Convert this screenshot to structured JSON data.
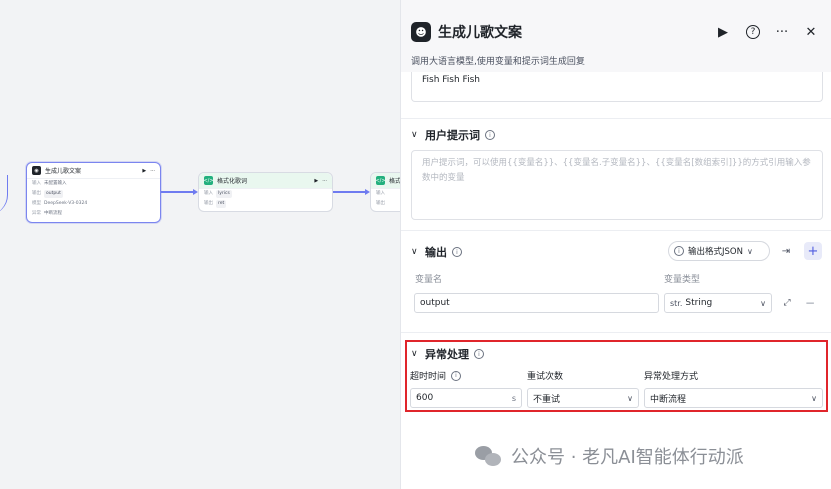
{
  "canvas": {
    "node1": {
      "title": "生成儿歌文案",
      "rows": [
        {
          "k": "输入",
          "v": "未配置输入"
        },
        {
          "k": "输出",
          "v": "output"
        },
        {
          "k": "模型",
          "v": "DeepSeek-V3-0324"
        },
        {
          "k": "异常",
          "v": "中断流程"
        }
      ]
    },
    "node2": {
      "title": "格式化歌词",
      "rows": [
        {
          "k": "输入",
          "v": "lyrics"
        },
        {
          "k": "输出",
          "v": "ret"
        }
      ]
    },
    "node3": {
      "title": "格式",
      "rows": [
        {
          "k": "输入",
          "v": ""
        },
        {
          "k": "输出",
          "v": ""
        }
      ]
    }
  },
  "panel": {
    "icon": "bot-icon",
    "title": "生成儿歌文案",
    "description": "调用大语言模型,使用变量和提示词生成回复",
    "system_prompt_value": "Fish Fish Fish",
    "user_prompt": {
      "title": "用户提示词",
      "placeholder": "用户提示词，可以使用{{变量名}}、{{变量名.子变量名}}、{{变量名[数组索引]}}的方式引用输入参数中的变量"
    },
    "output": {
      "title": "输出",
      "format_button": "输出格式JSON",
      "col_name": "变量名",
      "col_type": "变量类型",
      "var_name": "output",
      "var_type_prefix": "str.",
      "var_type": "String"
    },
    "exception": {
      "title": "异常处理",
      "timeout_label": "超时时间",
      "retry_label": "重试次数",
      "method_label": "异常处理方式",
      "timeout_value": "600",
      "timeout_unit": "s",
      "retry_value": "不重试",
      "method_value": "中断流程"
    }
  },
  "watermark": "公众号 · 老凡AI智能体行动派",
  "colors": {
    "accent": "#6f7bf0",
    "highlight_box": "#e0252b",
    "code_node": "#22b07d"
  }
}
